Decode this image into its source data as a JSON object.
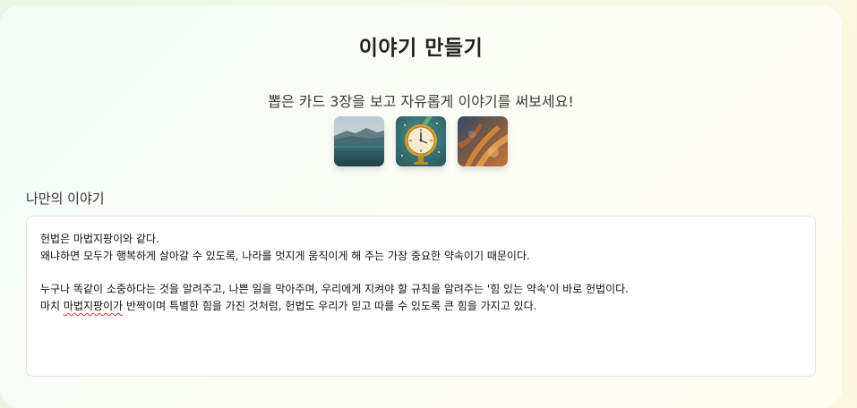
{
  "page": {
    "title": "이야기 만들기",
    "instruction": "뽑은 카드 3장을 보고 자유롭게 이야기를 써보세요!"
  },
  "cards": [
    {
      "name": "lake-landscape-card",
      "icon": "lake-mountains-image"
    },
    {
      "name": "clock-card",
      "icon": "gold-clock-image"
    },
    {
      "name": "autumn-leaves-card",
      "icon": "autumn-leaves-image"
    }
  ],
  "story": {
    "label": "나만의 이야기",
    "line1": "헌법은 마법지팡이와 같다.",
    "line2": "왜냐하면 모두가 행복하게 살아갈 수 있도록, 나라를 멋지게 움직이게 해 주는 가장 중요한 약속이기 때문이다.",
    "line3": "누구나 똑같이 소중하다는 것을 알려주고, 나쁜 일을 막아주며, 우리에게 지켜야 할 규칙을 알려주는 '힘 있는 약속'이 바로 헌법이다.",
    "line4_pre": "마치 ",
    "line4_misspelled": "마법지팡이가",
    "line4_post": " 반짝이며 특별한 힘을 가진 것처럼, 헌법도 우리가 믿고 따를 수 있도록 큰 힘을 가지고 있다."
  },
  "colors": {
    "spellcheck_underline": "#e0392b",
    "card_background": "#fcfdf7"
  }
}
